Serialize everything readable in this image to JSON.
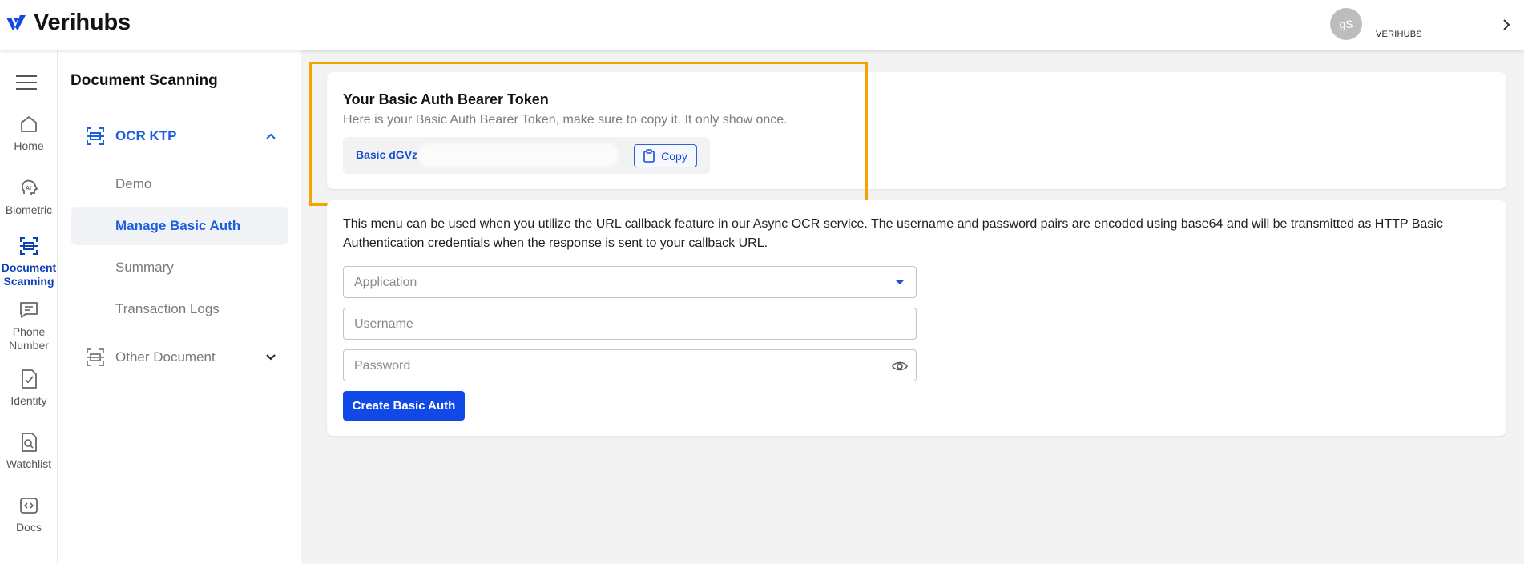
{
  "app": {
    "brand_name": "Verihubs",
    "account_initials": "gS",
    "account_name": "VERIHUBS"
  },
  "rail": {
    "items": [
      {
        "label": "Home",
        "icon": "home-icon"
      },
      {
        "label": "Biometric",
        "icon": "ai-face-icon"
      },
      {
        "label": "Document Scanning",
        "icon": "scan-icon",
        "active": true
      },
      {
        "label": "Phone Number",
        "icon": "message-icon"
      },
      {
        "label": "Identity",
        "icon": "identity-check-icon"
      },
      {
        "label": "Watchlist",
        "icon": "search-document-icon"
      },
      {
        "label": "Docs",
        "icon": "code-icon"
      }
    ]
  },
  "subnav": {
    "title": "Document Scanning",
    "groups": [
      {
        "label": "OCR KTP",
        "expanded": true,
        "items": [
          "Demo",
          "Manage Basic Auth",
          "Summary",
          "Transaction Logs"
        ],
        "active_item": "Manage Basic Auth"
      },
      {
        "label": "Other Document",
        "expanded": false
      }
    ]
  },
  "token_card": {
    "title": "Your Basic Auth Bearer Token",
    "description": "Here is your Basic Auth Bearer Token, make sure to copy it. It only show once.",
    "token_visible": "Basic dGVz",
    "copy_label": "Copy"
  },
  "form": {
    "description": "This menu can be used when you utilize the URL callback feature in our Async OCR service. The username and password pairs are encoded using base64 and will be transmitted as HTTP Basic Authentication credentials when the response is sent to your callback URL.",
    "application_placeholder": "Application",
    "username_placeholder": "Username",
    "password_placeholder": "Password",
    "submit_label": "Create Basic Auth"
  },
  "colors": {
    "accent": "#1149e8",
    "active_text": "#1a5fe0",
    "highlight": "#f5a300"
  }
}
